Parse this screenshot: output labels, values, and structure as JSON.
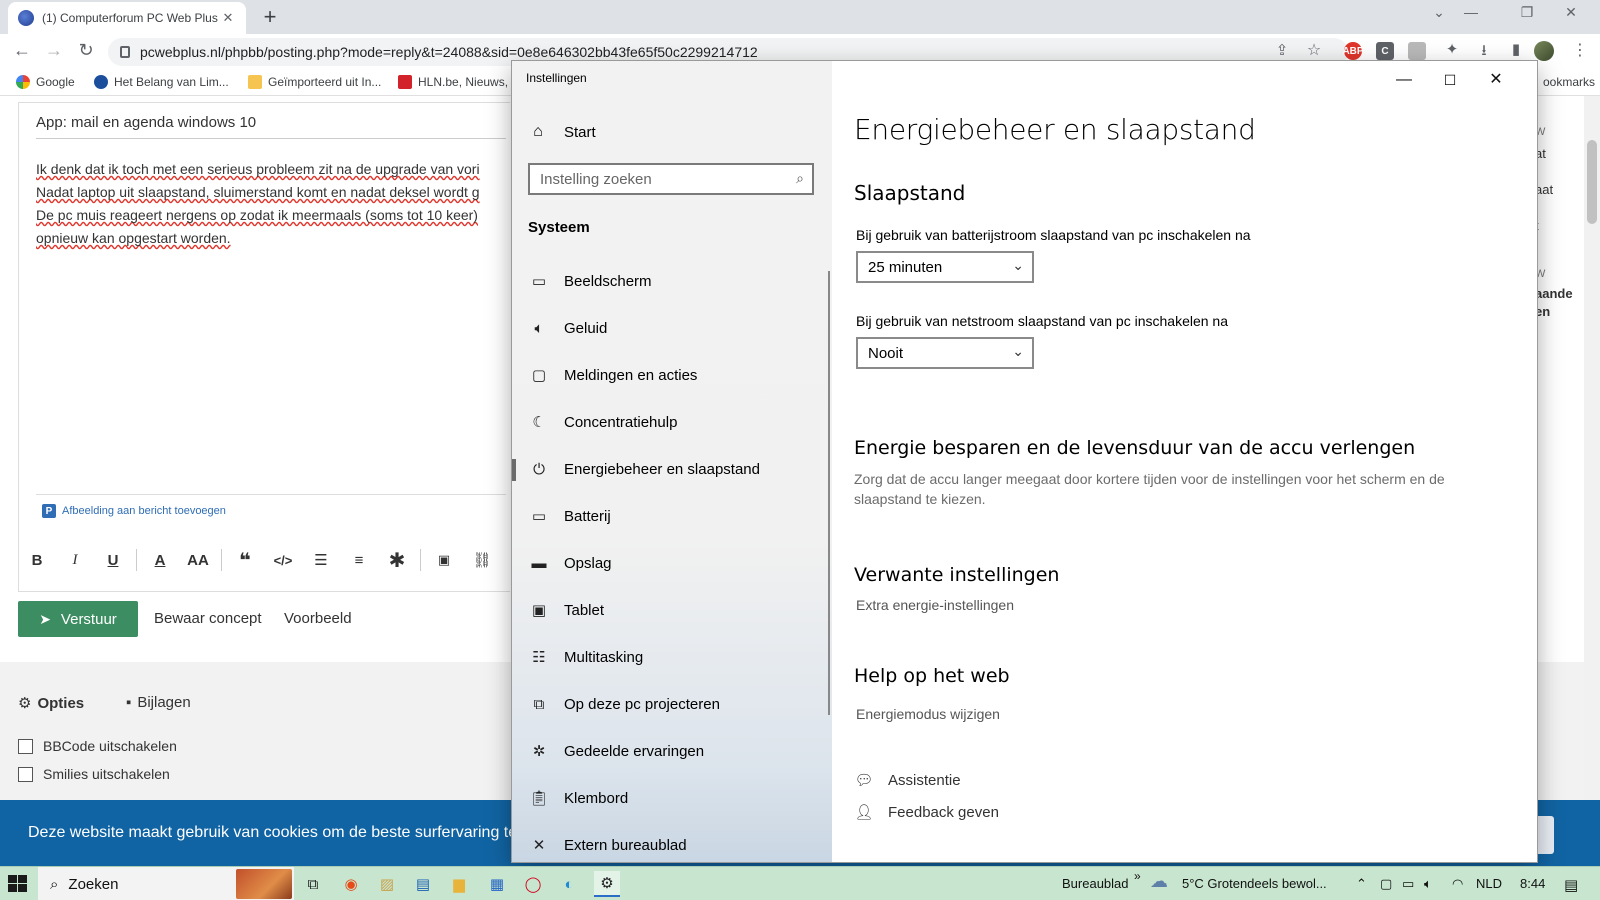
{
  "browser": {
    "tab_title": "(1) Computerforum PC Web Plus",
    "url": "pcwebplus.nl/phpbb/posting.php?mode=reply&t=24088&sid=0e8e646302bb43fe65f50c2299214712",
    "bookmarks": [
      "Google",
      "Het Belang van Lim...",
      "Geïmporteerd uit In...",
      "HLN.be, Nieuws,"
    ],
    "bookmarks_overflow": "ookmarks",
    "ext_abp": "ABP",
    "ext_c": "C"
  },
  "forum": {
    "subject": "App: mail en agenda windows 10",
    "body_lines": [
      "Ik denk dat ik toch met een serieus probleem zit na de upgrade van vori",
      "Nadat laptop uit slaapstand, sluimerstand komt en nadat deksel wordt g",
      "De pc muis reageert nergens op zodat ik meermaals (soms tot 10 keer)",
      "opnieuw kan opgestart worden."
    ],
    "add_image_link": "Afbeelding aan bericht toevoegen",
    "send_button": "Verstuur",
    "save_draft": "Bewaar concept",
    "preview": "Voorbeeld",
    "options_tab": "Opties",
    "attachments_tab": "Bijlagen",
    "checkbox_bbcode": "BBCode uitschakelen",
    "checkbox_smilies": "Smilies uitschakelen",
    "right_snippets": [
      "W",
      "at",
      "aat",
      "t",
      "W",
      "aande",
      "en"
    ]
  },
  "cookie_bar": {
    "text": "Deze website maakt gebruik van cookies om de beste surfervaring te"
  },
  "settings": {
    "window_title": "Instellingen",
    "home": "Start",
    "search_placeholder": "Instelling zoeken",
    "section": "Systeem",
    "nav_items": [
      {
        "label": "Beeldscherm",
        "icon": "monitor-icon"
      },
      {
        "label": "Geluid",
        "icon": "speaker-icon"
      },
      {
        "label": "Meldingen en acties",
        "icon": "notification-icon"
      },
      {
        "label": "Concentratiehulp",
        "icon": "moon-icon"
      },
      {
        "label": "Energiebeheer en slaapstand",
        "icon": "power-icon"
      },
      {
        "label": "Batterij",
        "icon": "battery-icon"
      },
      {
        "label": "Opslag",
        "icon": "storage-icon"
      },
      {
        "label": "Tablet",
        "icon": "tablet-icon"
      },
      {
        "label": "Multitasking",
        "icon": "multitasking-icon"
      },
      {
        "label": "Op deze pc projecteren",
        "icon": "project-icon"
      },
      {
        "label": "Gedeelde ervaringen",
        "icon": "shared-icon"
      },
      {
        "label": "Klembord",
        "icon": "clipboard-icon"
      },
      {
        "label": "Extern bureaublad",
        "icon": "remote-desktop-icon"
      }
    ],
    "selected_item": "Energiebeheer en slaapstand",
    "page_title": "Energiebeheer en slaapstand",
    "sleep_heading": "Slaapstand",
    "battery_label": "Bij gebruik van batterijstroom slaapstand van pc inschakelen na",
    "battery_value": "25 minuten",
    "ac_label": "Bij gebruik van netstroom slaapstand van pc inschakelen na",
    "ac_value": "Nooit",
    "save_heading": "Energie besparen en de levensduur van de accu verlengen",
    "save_desc": "Zorg dat de accu langer meegaat door kortere tijden voor de instellingen voor het scherm en de slaapstand te kiezen.",
    "related_heading": "Verwante instellingen",
    "related_link": "Extra energie-instellingen",
    "help_heading": "Help op het web",
    "help_link": "Energiemodus wijzigen",
    "assist": "Assistentie",
    "feedback": "Feedback geven"
  },
  "taskbar": {
    "search_text": "Zoeken",
    "desktop_label": "Bureaublad",
    "weather": "5°C  Grotendeels bewol...",
    "language": "NLD",
    "time": "8:44"
  }
}
